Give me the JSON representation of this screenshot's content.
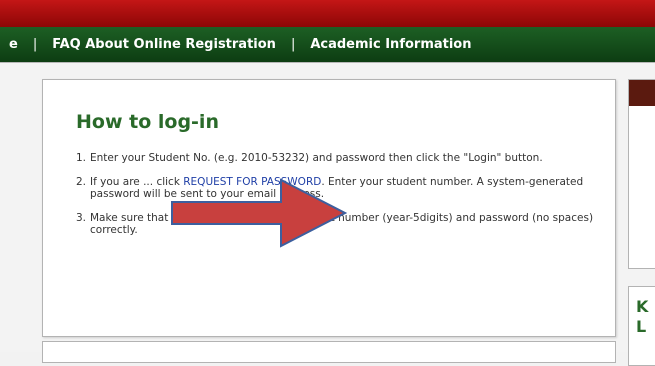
{
  "nav": {
    "partial_item": "e",
    "separator": "|",
    "faq_label": "FAQ About Online Registration",
    "academic_label": "Academic Information"
  },
  "login_help": {
    "title": "How to log-in",
    "steps": [
      {
        "num": "1.",
        "text": "Enter your Student No. (e.g. 2010-53232) and password then click the \"Login\" button."
      },
      {
        "num": "2.",
        "text_before": "If you ar",
        "hidden_by_arrow": "e ... clic",
        "text_mid": "k ",
        "link_label": "REQUEST FOR PASSWORD",
        "text_after": ". Enter your student number. A system-generated password will be sent to your email address."
      },
      {
        "num": "3.",
        "text": "Make sure that you have entered your student number (year-5digits) and password (no spaces) correctly."
      }
    ]
  },
  "right_box2": {
    "title_partial": "KL"
  },
  "colors": {
    "top_bar": "#b01010",
    "nav_bar": "#154d1b",
    "title_green": "#2a6a2a",
    "link_blue": "#1f3fa6",
    "arrow_red": "#c8403e",
    "arrow_border": "#3d5f9e"
  }
}
